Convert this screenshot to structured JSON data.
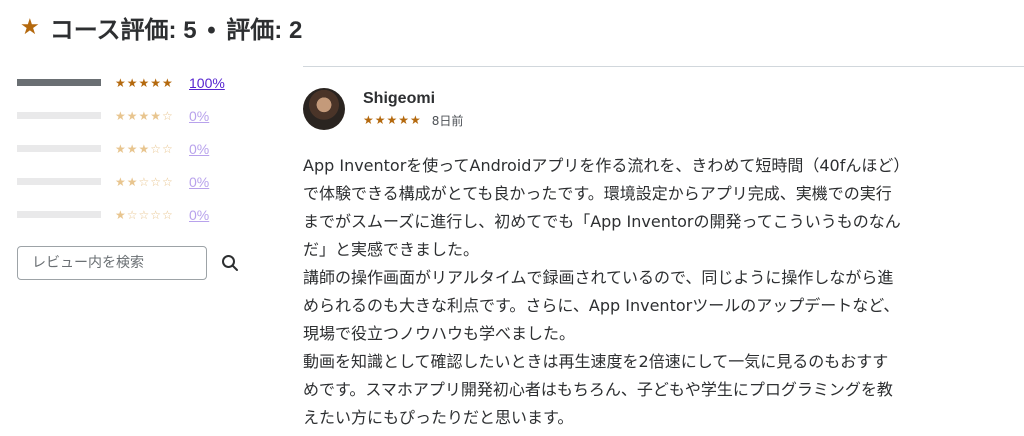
{
  "header": {
    "star_icon": "star-icon",
    "course_rating_label": "コース評価: 5",
    "separator": "•",
    "review_count_label": "評価: 2"
  },
  "rating_breakdown": [
    {
      "stars_display": "★★★★★",
      "percent": "100%",
      "fill_fraction": 1.0
    },
    {
      "stars_display": "★★★★☆",
      "percent": "0%",
      "fill_fraction": 0.0
    },
    {
      "stars_display": "★★★☆☆",
      "percent": "0%",
      "fill_fraction": 0.0
    },
    {
      "stars_display": "★★☆☆☆",
      "percent": "0%",
      "fill_fraction": 0.0
    },
    {
      "stars_display": "★☆☆☆☆",
      "percent": "0%",
      "fill_fraction": 0.0
    }
  ],
  "search": {
    "placeholder": "レビュー内を検索",
    "icon": "search-icon"
  },
  "review": {
    "reviewer_name": "Shigeomi",
    "stars_display": "★★★★★",
    "date": "8日前",
    "text": "App Inventorを使ってAndroidアプリを作る流れを、きわめて短時間（40fんほど）\nで体験できる構成がとても良かったです。環境設定からアプリ完成、実機での実行\nまでがスムーズに進行し、初めてでも「App Inventorの開発ってこういうものなん\nだ」と実感できました。\n講師の操作画面がリアルタイムで録画されているので、同じように操作しながら進\nめられるのも大きな利点です。さらに、App Inventorツールのアップデートなど、\n現場で役立つノウハウも学べました。\n動画を知識として確認したいときは再生速度を2倍速にして一気に見るのもおすす\nめです。スマホアプリ開発初心者はもちろん、子どもや学生にプログラミングを教\nえたい方にもぴったりだと思います。"
  },
  "colors": {
    "accent_star": "#b4690e",
    "link": "#5624d0",
    "bar_fill": "#6a6f73",
    "bar_track": "#e9e9ea"
  }
}
